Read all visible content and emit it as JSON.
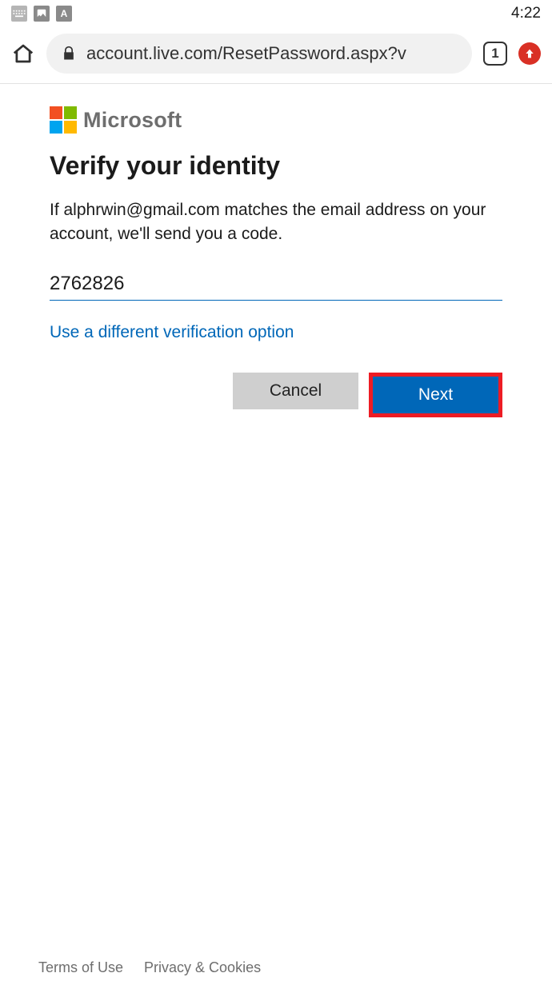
{
  "statusbar": {
    "time": "4:22"
  },
  "browser": {
    "url": "account.live.com/ResetPassword.aspx?v",
    "tab_count": "1"
  },
  "brand": {
    "name": "Microsoft"
  },
  "page": {
    "title": "Verify your identity",
    "body": "If alphrwin@gmail.com matches the email address on your account, we'll send you a code.",
    "code_value": "2762826",
    "alt_link": "Use a different verification option",
    "cancel_label": "Cancel",
    "next_label": "Next"
  },
  "footer": {
    "terms": "Terms of Use",
    "privacy": "Privacy & Cookies"
  }
}
